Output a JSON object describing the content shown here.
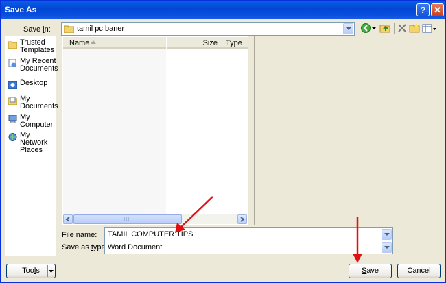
{
  "window": {
    "title": "Save As",
    "help_label": "?",
    "close_label": "✕"
  },
  "save_in": {
    "label_pre": "Save ",
    "label_key": "i",
    "label_post": "n:",
    "value": "tamil pc baner"
  },
  "places": [
    {
      "line1": "Trusted",
      "line2": "Templates",
      "icon": "folder-icon"
    },
    {
      "line1": "My Recent",
      "line2": "Documents",
      "icon": "recent-documents-icon"
    },
    {
      "line1": "Desktop",
      "line2": "",
      "icon": "desktop-icon"
    },
    {
      "line1": "My",
      "line2": "Documents",
      "icon": "my-documents-icon"
    },
    {
      "line1": "My",
      "line2": "Computer",
      "icon": "my-computer-icon"
    },
    {
      "line1": "My Network",
      "line2": "Places",
      "icon": "network-places-icon"
    }
  ],
  "columns": {
    "name": "Name",
    "size": "Size",
    "type": "Type"
  },
  "file_name": {
    "label_pre": "File ",
    "label_key": "n",
    "label_post": "ame:",
    "value": "TAMIL COMPUTER TIPS"
  },
  "save_type": {
    "label_pre": "Save as ",
    "label_key": "t",
    "label_post": "ype:",
    "value": "Word Document"
  },
  "buttons": {
    "tools_pre": "Too",
    "tools_key": "l",
    "tools_post": "s",
    "save_key": "S",
    "save_post": "ave",
    "cancel": "Cancel"
  },
  "colors": {
    "title_bar": "#0a5fe9",
    "dialog_bg": "#ece9d8",
    "annotation_arrow": "#e01010"
  }
}
